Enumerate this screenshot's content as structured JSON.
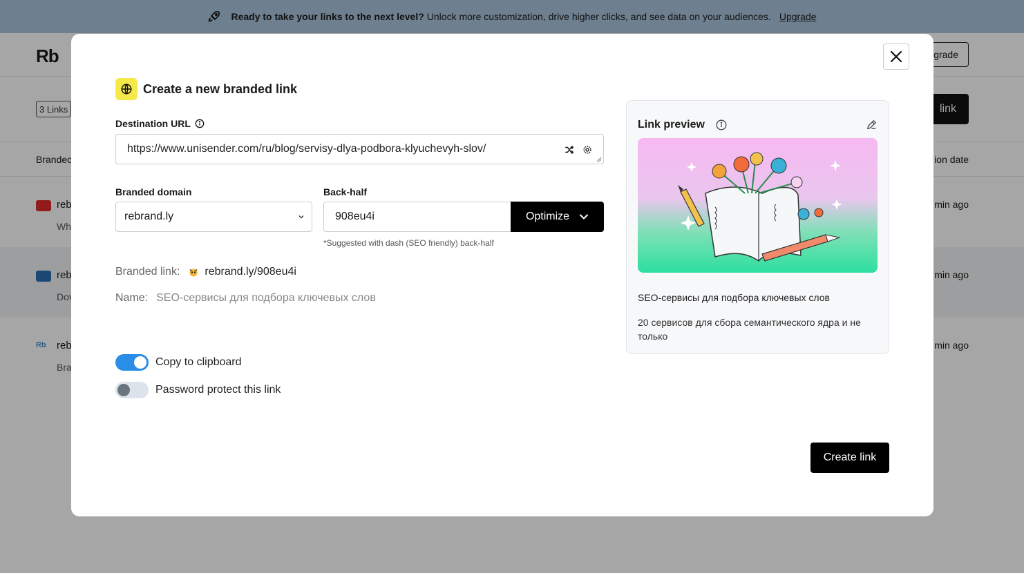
{
  "banner": {
    "bold": "Ready to take your links to the next level?",
    "text": "Unlock more customization, drive higher clicks, and see data on your audiences.",
    "link": "Upgrade"
  },
  "app": {
    "logo": "Rb",
    "upgrade_fragment": "grade",
    "links_count": "3 Links",
    "new_link_fragment": "link",
    "col_left": "Brandec",
    "col_right": "ion date",
    "rows": [
      {
        "t1": "reb",
        "t2": "Wh",
        "ago": "min ago",
        "icon_color": "#e02a2a"
      },
      {
        "t1": "reb",
        "t2": "Dov",
        "ago": "min ago",
        "icon_color": "#2a6fb3"
      },
      {
        "t1": "reb",
        "t2": "Bra",
        "ago": "min ago",
        "icon_color": "#4a8fd4"
      }
    ]
  },
  "modal": {
    "title": "Create a new branded link",
    "destination_label": "Destination URL",
    "destination_value": "https://www.unisender.com/ru/blog/servisy-dlya-podbora-klyuchevyh-slov/",
    "domain_label": "Branded domain",
    "domain_value": "rebrand.ly",
    "backhalf_label": "Back-half",
    "backhalf_value": "908eu4i",
    "optimize_label": "Optimize",
    "hint": "*Suggested with dash (SEO friendly) back-half",
    "branded_link_label": "Branded link:",
    "branded_link_value": "rebrand.ly/908eu4i",
    "name_label": "Name:",
    "name_value": "SEO-сервисы для подбора ключевых слов",
    "copy_label": "Copy to clipboard",
    "copy_on": true,
    "password_label": "Password protect this link",
    "password_on": false,
    "create_label": "Create link"
  },
  "preview": {
    "title": "Link preview",
    "page_title": "SEO-сервисы для подбора ключевых слов",
    "description": "20 сервисов для сбора семантического ядра и не только"
  },
  "colors": {
    "accent": "#2b8ee6",
    "banner_bg": "#a9c3dc",
    "globe_bg": "#f5e94a",
    "button_bg": "#000000"
  }
}
